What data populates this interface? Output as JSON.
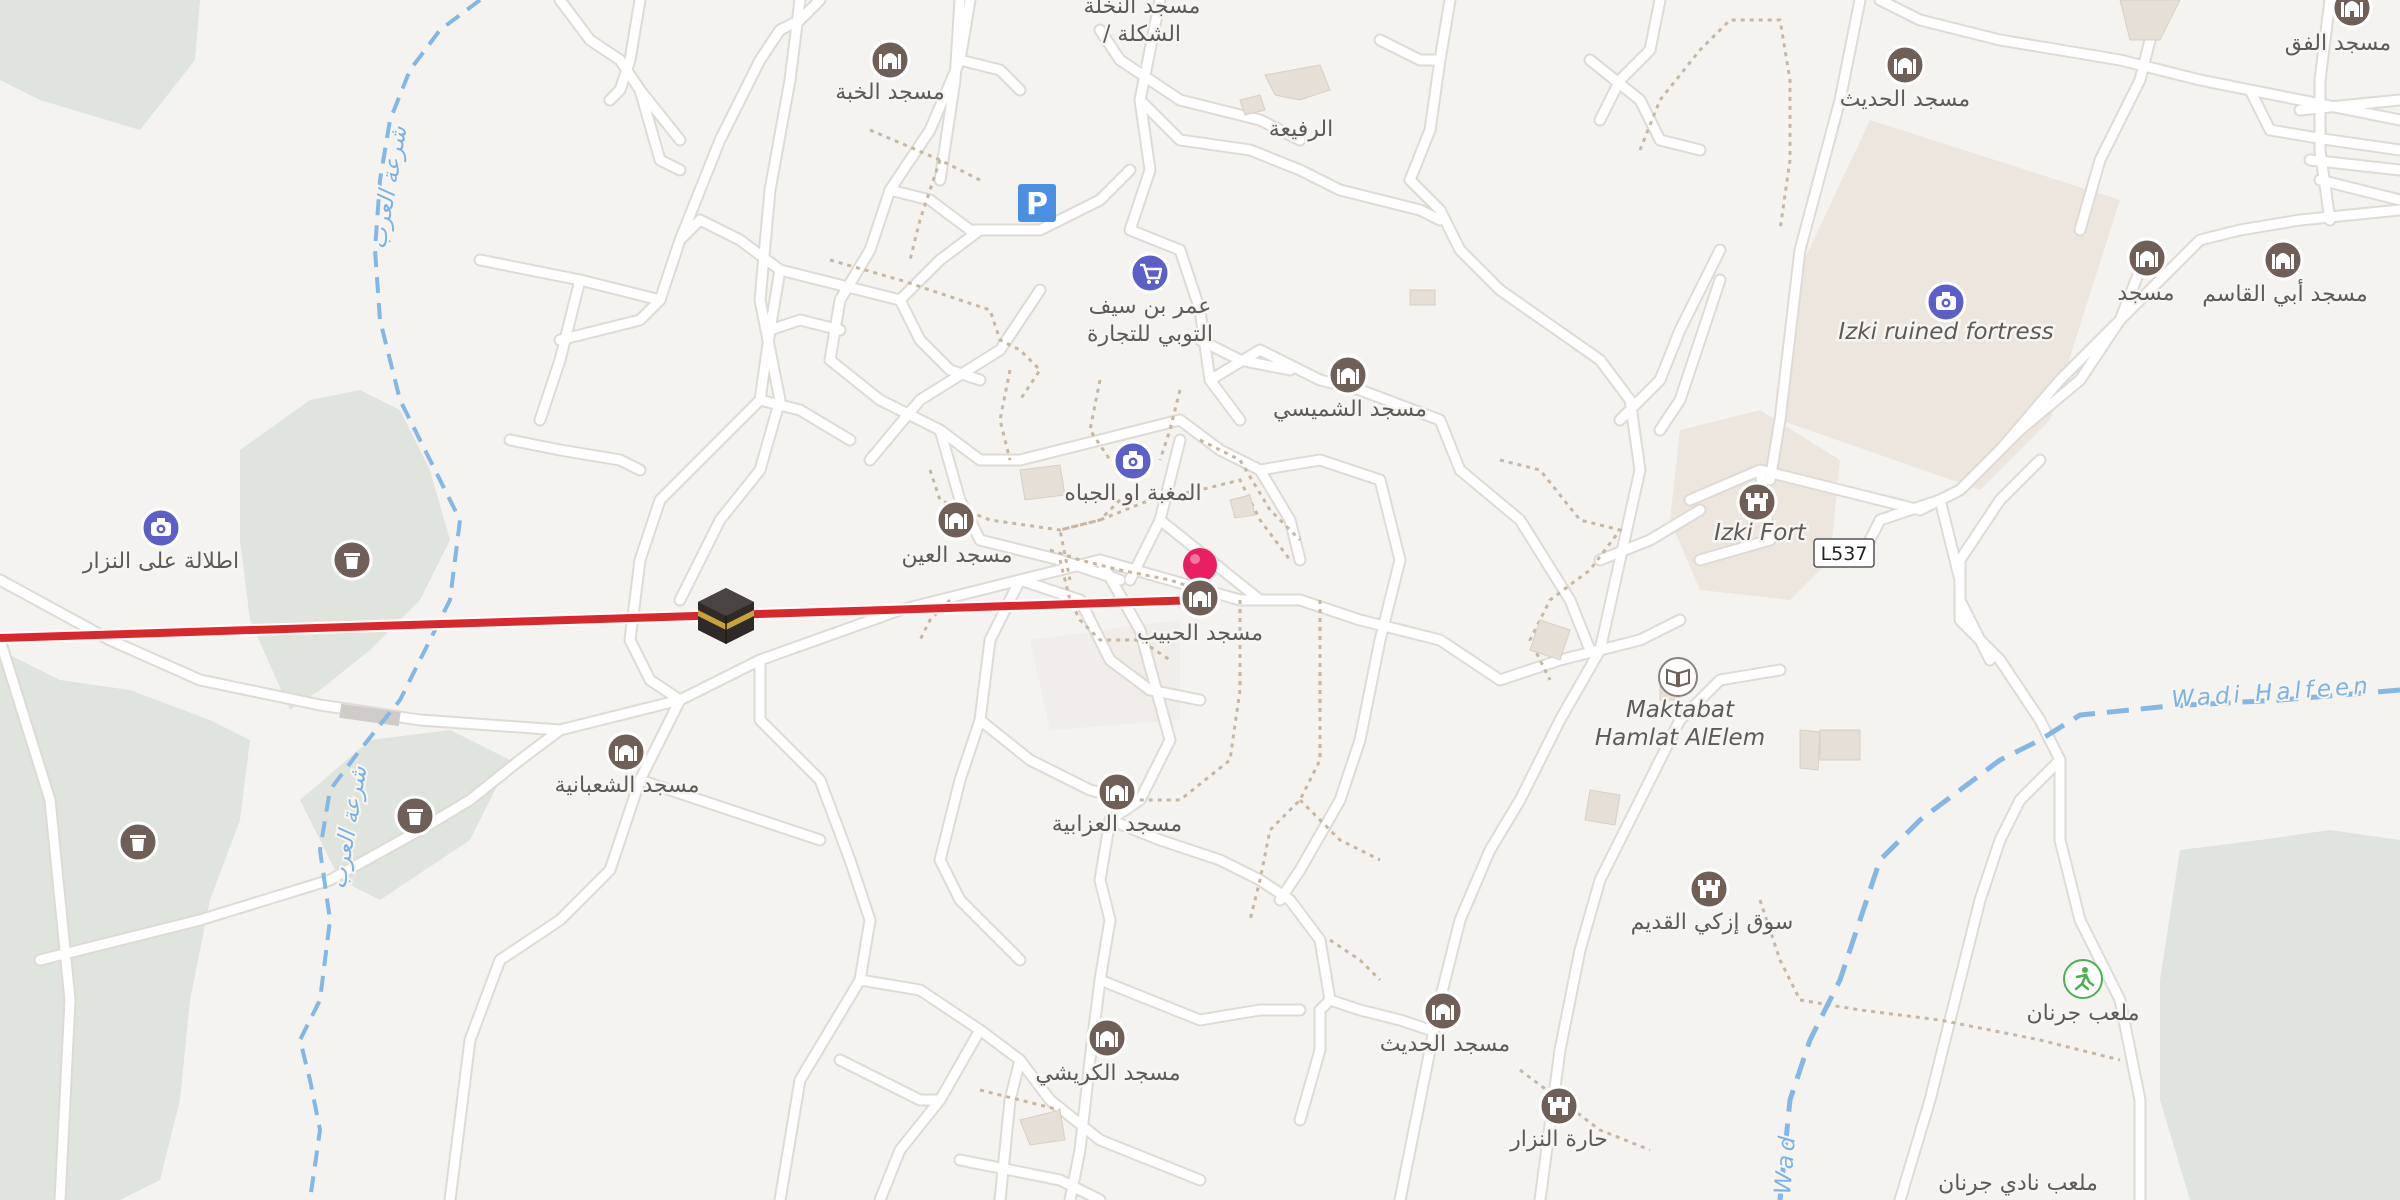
{
  "map": {
    "colors": {
      "background": "#f5f3f0",
      "road": "#ffffff",
      "road_casing": "#dedad6",
      "path": "#c8b6a0",
      "green_area": "#dfe4dc",
      "building_area": "#ede6de",
      "water": "#82b7e6",
      "route_line": "#d9282c",
      "pin": "#e91e63",
      "poi_icon_fill": "#6f5f57",
      "poi_photo_fill": "#5b5fc7",
      "parking_fill": "#4a90e2",
      "leisure_fill": "#4caf50"
    },
    "road_shield": "L537",
    "parking_label": "P",
    "waterway_labels": {
      "wadi_halfeen": "Wadi Halfeen",
      "wadi_partial": "Wad",
      "sharia_alarb_1": "شرعة العرب",
      "sharia_alarb_2": "شرعة العرب"
    },
    "labels": {
      "masjid_alnakhla": "مسجد النخلة",
      "alshakla": "/ الشكلة",
      "masjid_alkhuba": "مسجد الخبة",
      "alrafea": "الرفيعة",
      "masjid_alhadith_top": "مسجد الحديث",
      "masjid_alfaqih": "مسجد الفق",
      "omar_line1": "عمر بن سيف",
      "omar_line2": "التوبي للتجارة",
      "masjid_alshamisi": "مسجد الشميسي",
      "masjid_short": "مسجد",
      "masjid_abi_alqasim": "مسجد أبي القاسم",
      "izki_ruined_fortress": "Izki ruined fortress",
      "almaghba": "المغبة او الجباه",
      "itlala": "اطلالة على النزار",
      "masjid_alain": "مسجد العين",
      "izki_fort": "Izki Fort",
      "masjid_alhabib": "مسجد الحبيب",
      "maktabat_line1": "Maktabat",
      "maktabat_line2": "Hamlat AlElem",
      "masjid_alshabaniya": "مسجد الشعبانية",
      "masjid_alazabiya": "مسجد العزابية",
      "souq_izki": "سوق إزكي القديم",
      "malab_jarnan": "ملعب جرنان",
      "masjid_alkurishi": "مسجد الكريشي",
      "masjid_alhadith_bottom": "مسجد الحديث",
      "harat_alnizar": "حارة النزار",
      "malab_nadi_jarnan": "ملعب نادي جرنان"
    }
  }
}
